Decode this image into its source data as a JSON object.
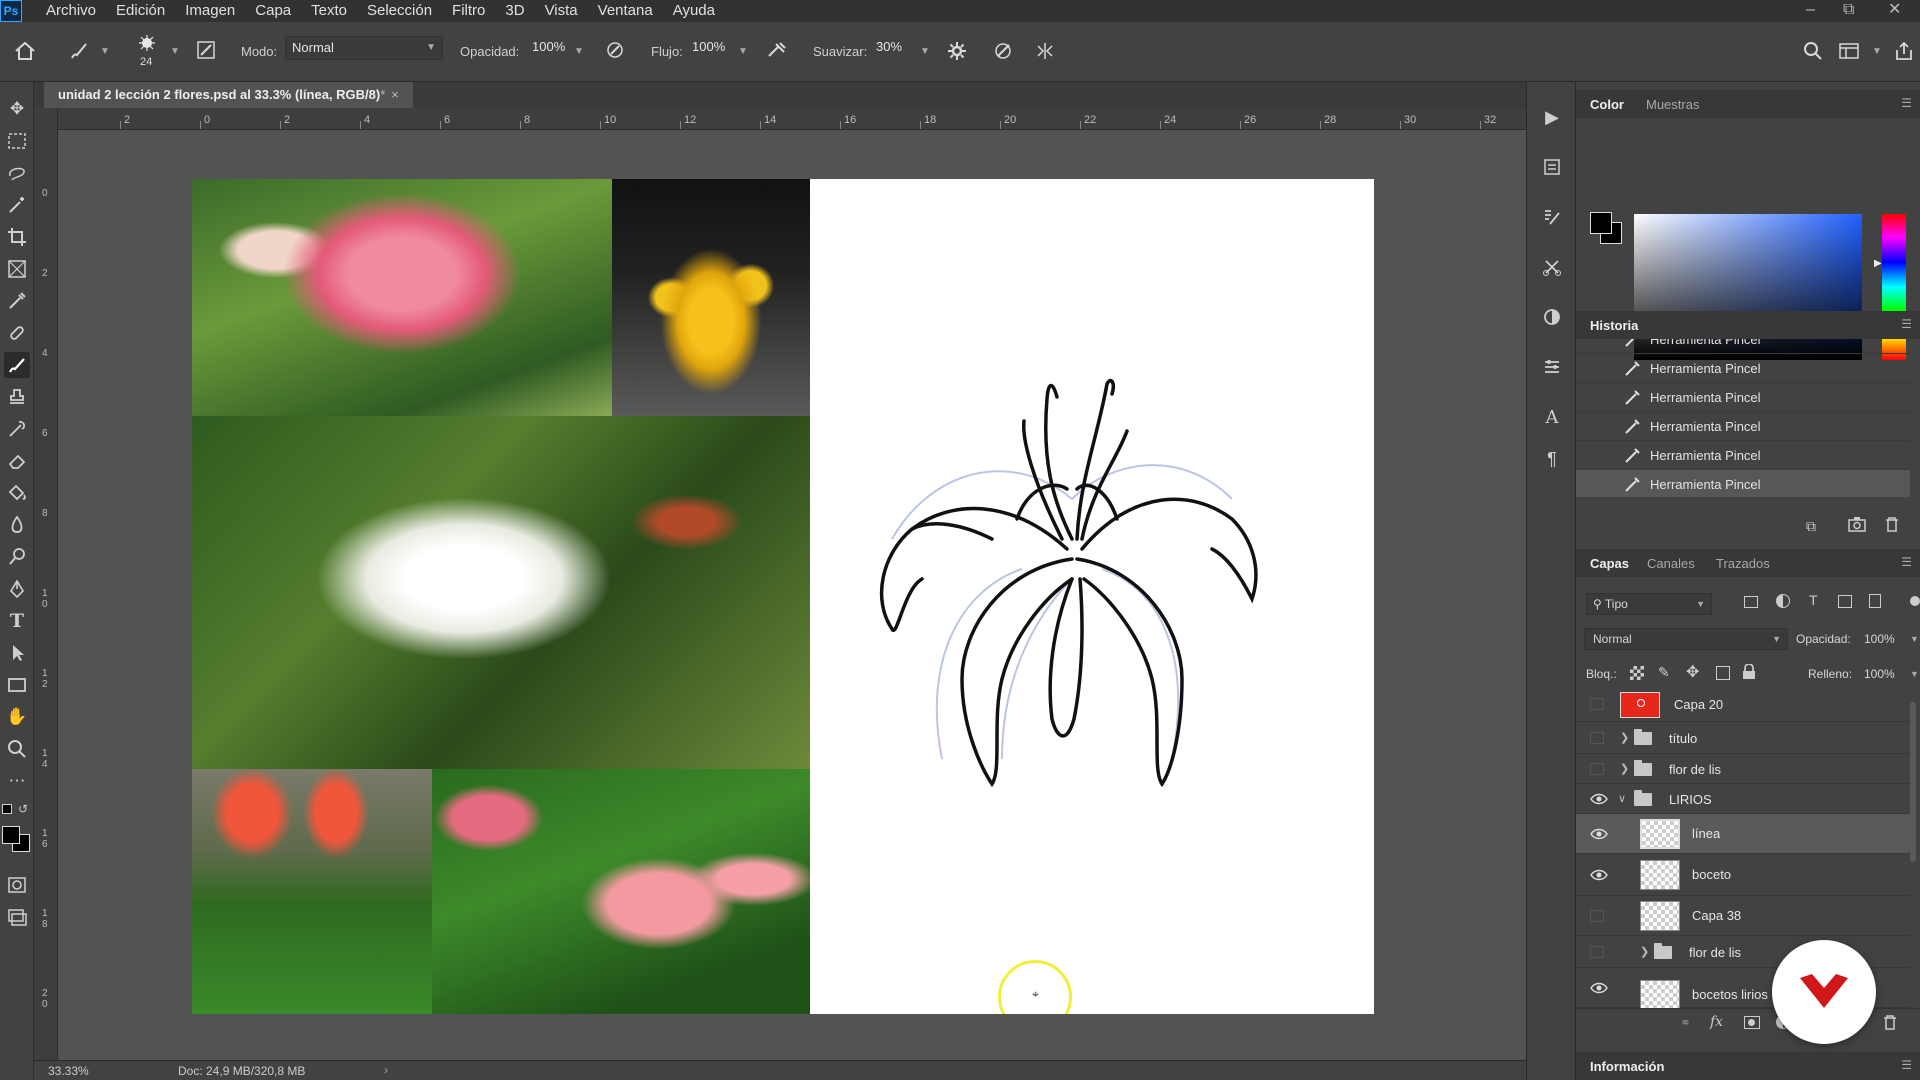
{
  "app": {
    "logo": "Ps"
  },
  "menu": [
    "Archivo",
    "Edición",
    "Imagen",
    "Capa",
    "Texto",
    "Selección",
    "Filtro",
    "3D",
    "Vista",
    "Ventana",
    "Ayuda"
  ],
  "options": {
    "brush_size": "24",
    "mode_label": "Modo:",
    "mode_value": "Normal",
    "opacity_label": "Opacidad:",
    "opacity_value": "100%",
    "flow_label": "Flujo:",
    "flow_value": "100%",
    "smooth_label": "Suavizar:",
    "smooth_value": "30%"
  },
  "document": {
    "tab_title": "unidad 2 lección 2 flores.psd al 33.3% (línea, RGB/8)",
    "tab_modified": "*",
    "zoom": "33.33%",
    "doc_info": "Doc: 24,9 MB/320,8 MB"
  },
  "ruler": {
    "top_labels": [
      "2",
      "0",
      "2",
      "4",
      "6",
      "8",
      "10",
      "12",
      "14",
      "16",
      "18",
      "20",
      "22",
      "24",
      "26",
      "28",
      "30",
      "32"
    ],
    "left_labels": [
      "0",
      "2",
      "4",
      "6",
      "8",
      "10",
      "12",
      "14",
      "16",
      "18",
      "20"
    ]
  },
  "color_panel": {
    "tabs": [
      "Color",
      "Muestras"
    ]
  },
  "history_panel": {
    "title": "Historia",
    "items": [
      "Herramienta Pincel",
      "Herramienta Pincel",
      "Herramienta Pincel",
      "Herramienta Pincel",
      "Herramienta Pincel",
      "Herramienta Pincel"
    ]
  },
  "layers_panel": {
    "tabs": [
      "Capas",
      "Canales",
      "Trazados"
    ],
    "filter_label": "Tipo",
    "blend_mode": "Normal",
    "opacity_label": "Opacidad:",
    "opacity_value": "100%",
    "lock_label": "Bloq.:",
    "fill_label": "Relleno:",
    "fill_value": "100%",
    "layers": [
      {
        "name": "Capa 20",
        "visible": false,
        "kind": "fill-red"
      },
      {
        "name": "título",
        "visible": false,
        "kind": "group"
      },
      {
        "name": "flor de lis",
        "visible": false,
        "kind": "group"
      },
      {
        "name": "LIRIOS",
        "visible": true,
        "kind": "group-open"
      },
      {
        "name": "línea",
        "visible": true,
        "kind": "layer",
        "selected": true
      },
      {
        "name": "boceto",
        "visible": true,
        "kind": "layer"
      },
      {
        "name": "Capa 38",
        "visible": false,
        "kind": "layer"
      },
      {
        "name": "flor de lis",
        "visible": false,
        "kind": "group"
      },
      {
        "name": "bocetos lirios",
        "visible": true,
        "kind": "layer"
      }
    ]
  },
  "info_panel": {
    "title": "Información"
  },
  "colors": {
    "accent_red": "#e8271c",
    "selection": "#5a5a5a",
    "brush_cursor": "#f2ef3a"
  }
}
